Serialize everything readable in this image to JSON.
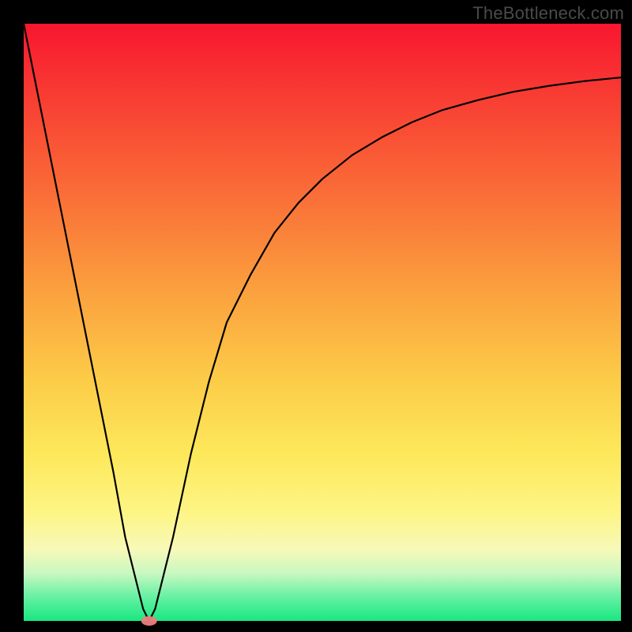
{
  "attribution": "TheBottleneck.com",
  "chart_data": {
    "type": "line",
    "title": "",
    "xlabel": "",
    "ylabel": "",
    "xlim": [
      0,
      100
    ],
    "ylim": [
      0,
      100
    ],
    "grid": false,
    "legend": false,
    "series": [
      {
        "name": "bottleneck-curve",
        "x": [
          0,
          3,
          6,
          9,
          12,
          15,
          17,
          19,
          20,
          21,
          22,
          23,
          25,
          28,
          31,
          34,
          38,
          42,
          46,
          50,
          55,
          60,
          65,
          70,
          76,
          82,
          88,
          94,
          100
        ],
        "y": [
          100,
          85,
          70,
          55,
          40,
          25,
          14,
          6,
          2,
          0,
          2,
          6,
          14,
          28,
          40,
          50,
          58,
          65,
          70,
          74,
          78,
          81,
          83.5,
          85.5,
          87.2,
          88.6,
          89.6,
          90.4,
          91
        ]
      }
    ],
    "marker": {
      "name": "optimal-point",
      "x": 21,
      "y": 0,
      "color": "#ef7d7d"
    }
  }
}
